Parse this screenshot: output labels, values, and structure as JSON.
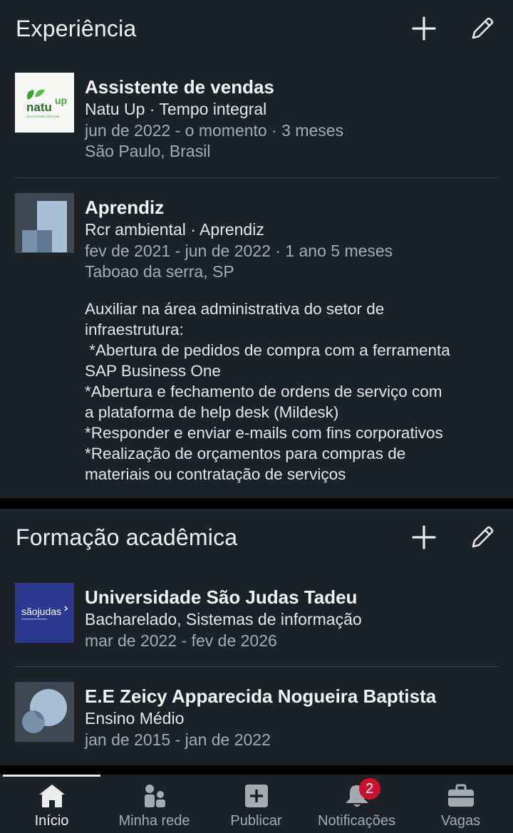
{
  "experience": {
    "title": "Experiência",
    "entries": [
      {
        "role": "Assistente de vendas",
        "company": "Natu Up · Tempo integral",
        "dates": "jun de 2022 - o momento · 3 meses",
        "location": "São Paulo, Brasil",
        "logo": {
          "text_top": "natu",
          "text_side": "up",
          "tagline": "SUA SAÚDE LEVA UM"
        }
      },
      {
        "role": "Aprendiz",
        "company": "Rcr ambiental · Aprendiz",
        "dates": "fev de 2021 - jun de 2022 · 1 ano 5 meses",
        "location": "Taboao da serra, SP",
        "description": [
          "Auxiliar na área administrativa do setor de",
          "infraestrutura:",
          " *Abertura de pedidos de compra com a ferramenta",
          "SAP Business One",
          "*Abertura e fechamento de ordens de serviço com",
          "a plataforma de help desk (Mildesk)",
          "*Responder e enviar e-mails com fins corporativos",
          "*Realização de orçamentos para compras de",
          "materiais ou contratação de serviços"
        ]
      }
    ]
  },
  "education": {
    "title": "Formação acadêmica",
    "entries": [
      {
        "school": "Universidade São Judas Tadeu",
        "degree": "Bacharelado, Sistemas de informação",
        "dates": "mar de 2022 - fev de 2026",
        "logo": {
          "text": "sãojudas"
        }
      },
      {
        "school": "E.E Zeicy Apparecida Nogueira Baptista",
        "degree": "Ensino Médio",
        "dates": "jan de 2015 - jan de 2022"
      }
    ]
  },
  "nav": {
    "items": [
      {
        "label": "Início",
        "icon": "home-icon"
      },
      {
        "label": "Minha rede",
        "icon": "network-icon"
      },
      {
        "label": "Publicar",
        "icon": "post-icon"
      },
      {
        "label": "Notificações",
        "icon": "bell-icon",
        "badge": "2"
      },
      {
        "label": "Vagas",
        "icon": "briefcase-icon"
      }
    ]
  },
  "colors": {
    "background": "#1d2226",
    "separator": "#000000",
    "badge": "#cb112d",
    "natu_green": "#4caf50",
    "saojudas_blue": "#2b3990"
  }
}
